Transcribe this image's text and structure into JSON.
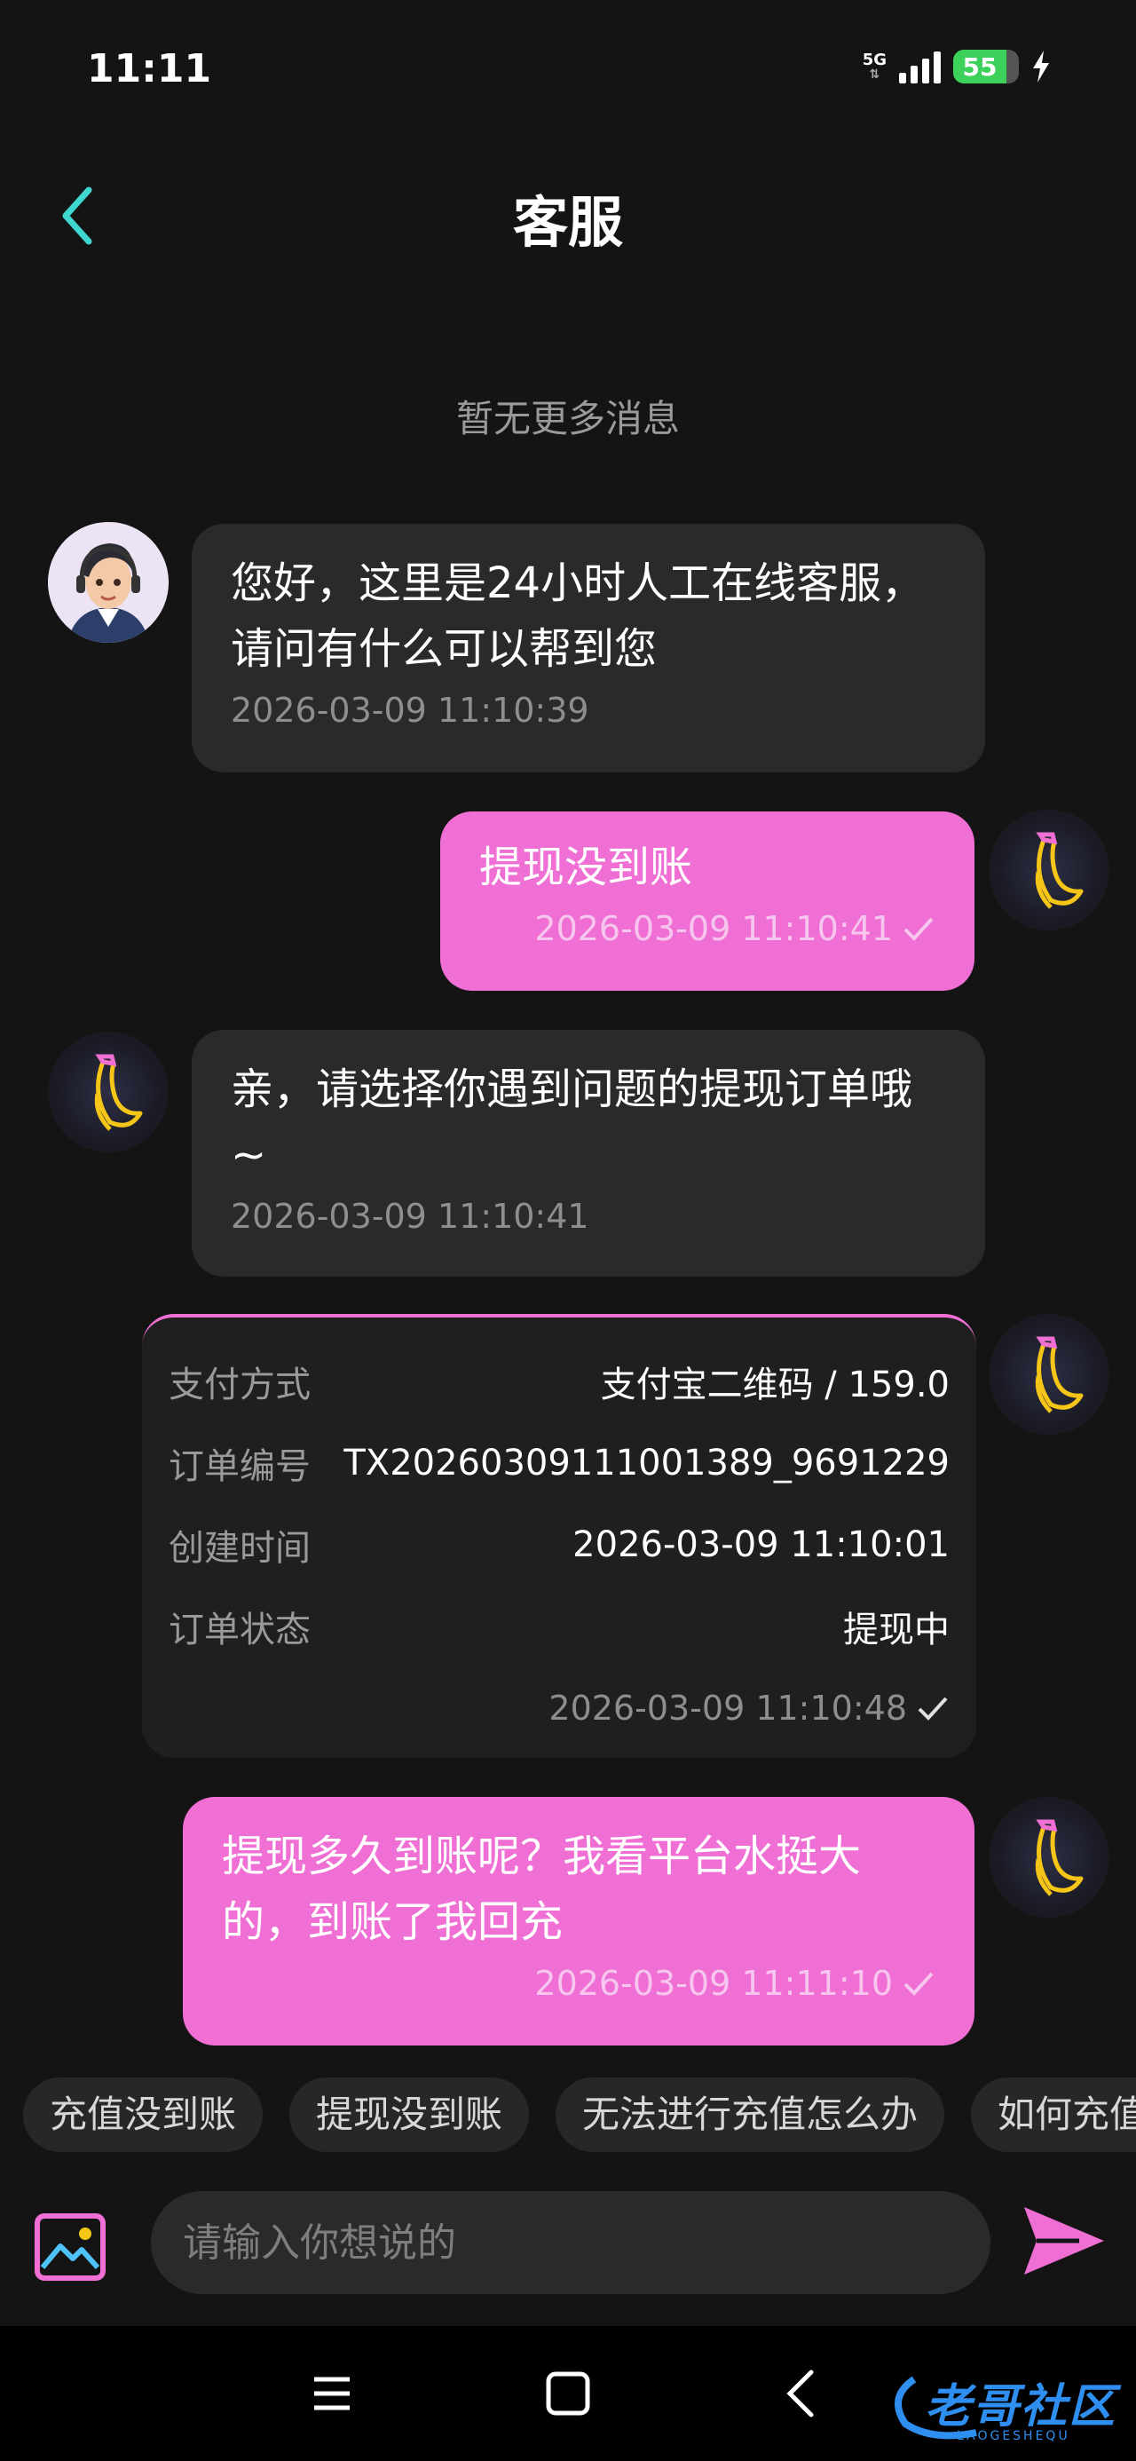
{
  "status_bar": {
    "time": "11:11",
    "network": "5G",
    "battery": "55"
  },
  "header": {
    "title": "客服"
  },
  "chat": {
    "no_more": "暂无更多消息",
    "messages": [
      {
        "text": "您好，这里是24小时人工在线客服，请问有什么可以帮到您",
        "time": "2026-03-09 11:10:39"
      },
      {
        "text": "提现没到账",
        "time": "2026-03-09 11:10:41"
      },
      {
        "text": "亲，请选择你遇到问题的提现订单哦~",
        "time": "2026-03-09 11:10:41"
      },
      {
        "text": "提现多久到账呢？我看平台水挺大的，到账了我回充",
        "time": "2026-03-09 11:11:10"
      }
    ],
    "order_card": {
      "rows": [
        {
          "label": "支付方式",
          "value": "支付宝二维码 / 159.0"
        },
        {
          "label": "订单编号",
          "value": "TX20260309111001389_9691229"
        },
        {
          "label": "创建时间",
          "value": "2026-03-09 11:10:01"
        },
        {
          "label": "订单状态",
          "value": "提现中"
        }
      ],
      "time": "2026-03-09 11:10:48"
    }
  },
  "quick_replies": [
    "充值没到账",
    "提现没到账",
    "无法进行充值怎么办",
    "如何充值"
  ],
  "input": {
    "placeholder": "请输入你想说的"
  },
  "watermark": {
    "text": "老哥社区",
    "sub": "LAOGESHEQU"
  },
  "colors": {
    "accent": "#f06fd4",
    "back_arrow": "#3fd6d0",
    "incoming_bubble": "#2a2a2a",
    "background": "#141414"
  }
}
